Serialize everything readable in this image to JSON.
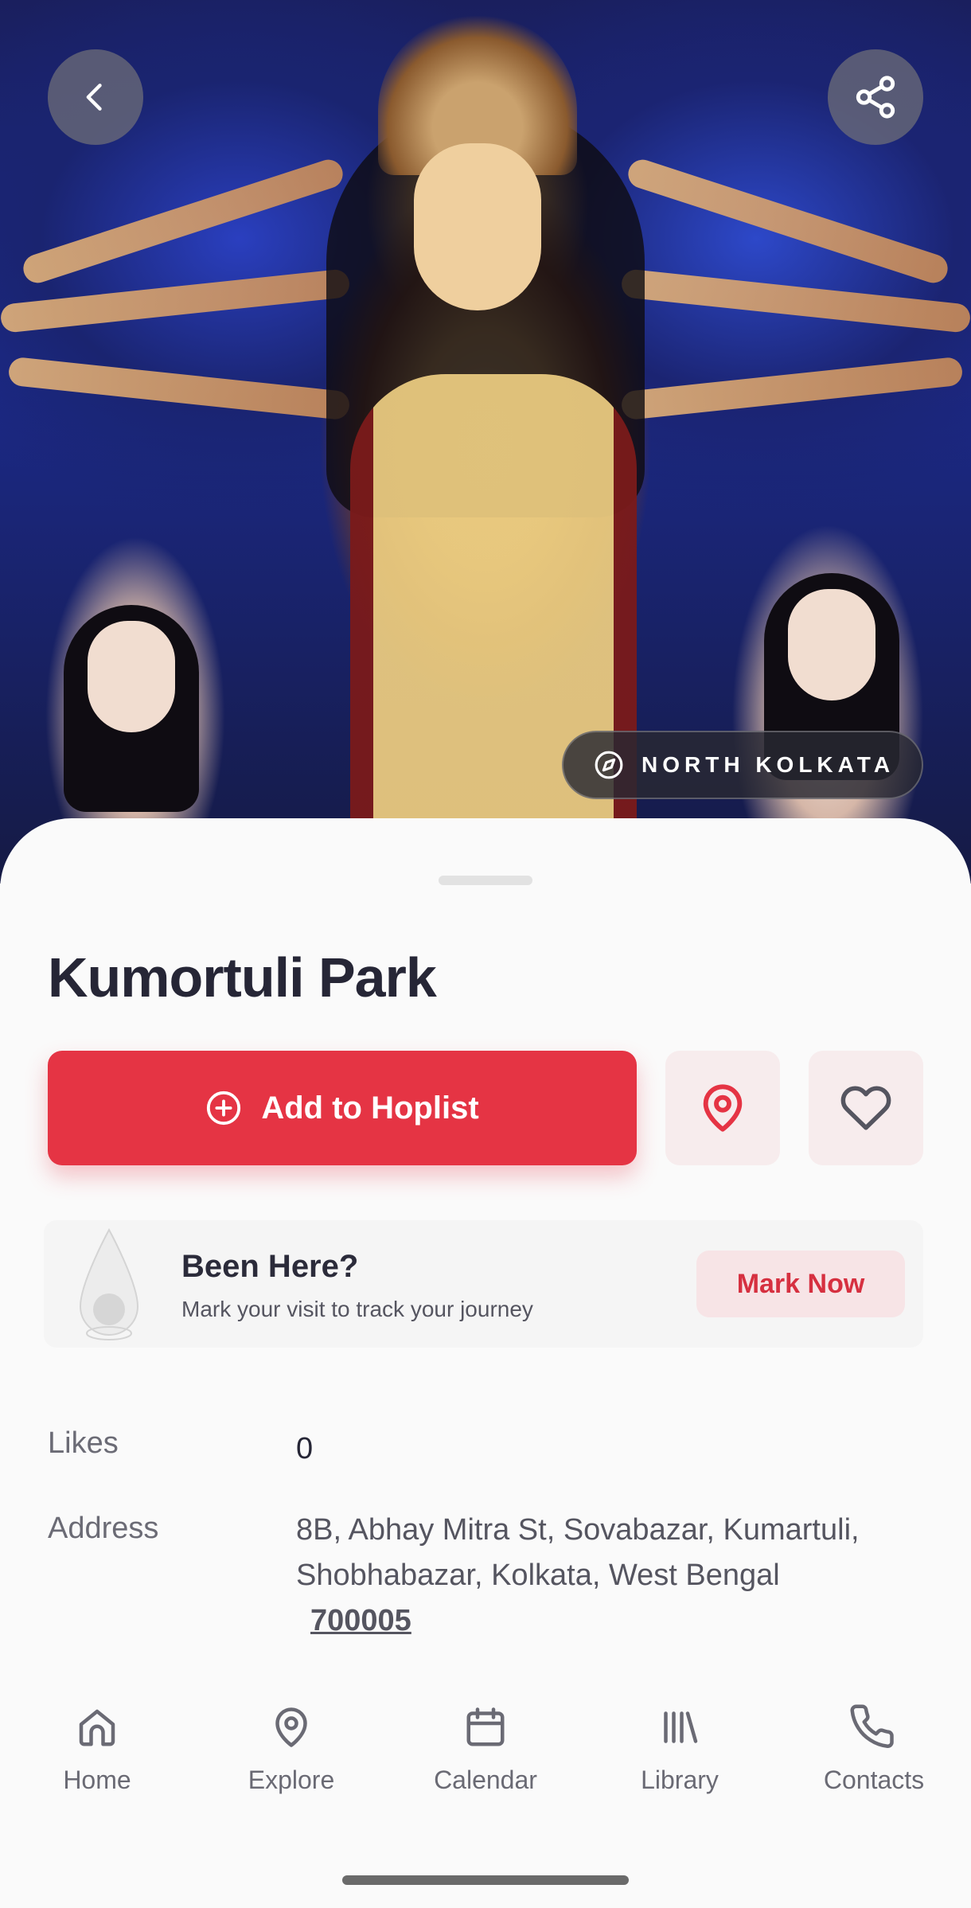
{
  "hero": {
    "region_label": "NORTH KOLKATA",
    "icons": {
      "back": "chevron-left-icon",
      "share": "share-icon",
      "region": "compass-icon"
    }
  },
  "place": {
    "title": "Kumortuli Park"
  },
  "actions": {
    "add_label": "Add to Hoplist",
    "add_icon": "plus-circle-icon",
    "location_icon": "map-pin-icon",
    "favorite_icon": "heart-icon"
  },
  "been_here": {
    "title": "Been Here?",
    "subtitle": "Mark your visit to track your journey",
    "button_label": "Mark Now"
  },
  "details": {
    "likes_label": "Likes",
    "likes_value": "0",
    "address_label": "Address",
    "address_value": "8B, Abhay Mitra St, Sovabazar, Kumartuli, Shobhabazar, Kolkata, West Bengal",
    "address_pin": "700005"
  },
  "nav": {
    "items": [
      {
        "label": "Home",
        "icon": "home-icon"
      },
      {
        "label": "Explore",
        "icon": "map-pin-icon"
      },
      {
        "label": "Calendar",
        "icon": "calendar-icon"
      },
      {
        "label": "Library",
        "icon": "library-icon"
      },
      {
        "label": "Contacts",
        "icon": "phone-icon"
      }
    ]
  },
  "colors": {
    "accent": "#e53444",
    "accent_soft": "#f7eced",
    "text_dark": "#262636",
    "text_muted": "#6b6b75"
  }
}
